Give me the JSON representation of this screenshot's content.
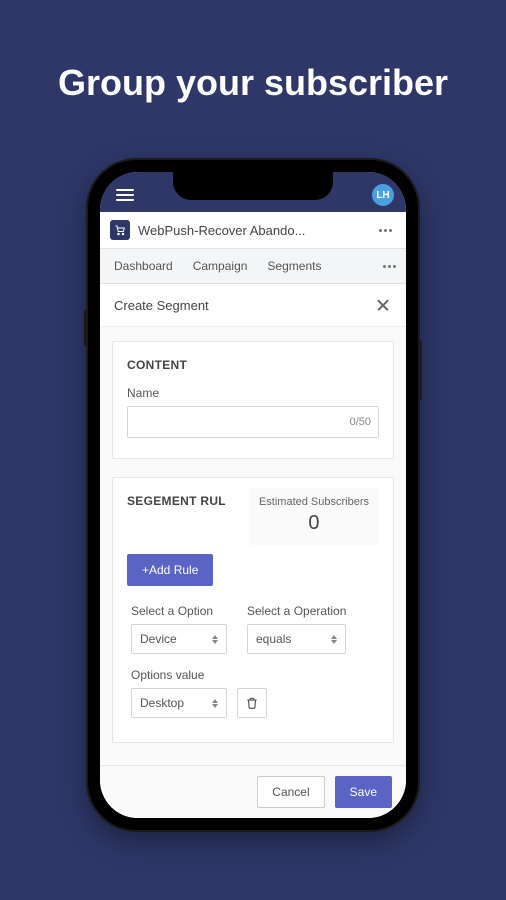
{
  "headline": "Group your subscriber",
  "topbar": {
    "avatar_initials": "LH"
  },
  "app": {
    "name": "WebPush-Recover Abando...",
    "icon": "cart-icon"
  },
  "tabs": [
    "Dashboard",
    "Campaign",
    "Segments"
  ],
  "section": {
    "title": "Create Segment"
  },
  "content_card": {
    "heading": "CONTENT",
    "name_label": "Name",
    "name_value": "",
    "name_counter": "0/50"
  },
  "rules_card": {
    "heading": "SEGEMENT RUL",
    "estimated_label": "Estimated Subscribers",
    "estimated_value": "0",
    "add_rule_label": "+Add Rule",
    "option_label": "Select a Option",
    "option_value": "Device",
    "operation_label": "Select a Operation",
    "operation_value": "equals",
    "value_label": "Options value",
    "value_value": "Desktop"
  },
  "footer": {
    "cancel": "Cancel",
    "save": "Save"
  }
}
